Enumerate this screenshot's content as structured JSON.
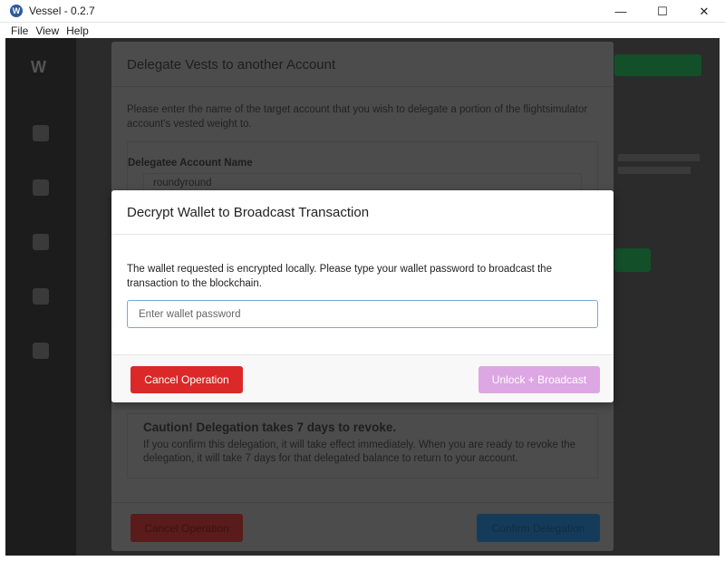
{
  "window": {
    "title": "Vessel - 0.2.7",
    "app_icon_glyph": "W",
    "minimize_glyph": "—",
    "maximize_glyph": "☐",
    "close_glyph": "✕"
  },
  "menu": [
    {
      "label": "File"
    },
    {
      "label": "View"
    },
    {
      "label": "Help"
    }
  ],
  "delegate_modal": {
    "title": "Delegate Vests to another Account",
    "description": "Please enter the name of the target account that you wish to delegate a portion of the flightsimulator account's vested weight to.",
    "field_label": "Delegatee Account Name",
    "field_value": "roundyround",
    "caution_title": "Caution! Delegation takes 7 days to revoke.",
    "caution_text": "If you confirm this delegation, it will take effect immediately. When you are ready to revoke the delegation, it will take 7 days for that delegated balance to return to your account.",
    "cancel_label": "Cancel Operation",
    "confirm_label": "Confirm Delegation"
  },
  "decrypt_modal": {
    "title": "Decrypt Wallet to Broadcast Transaction",
    "description": "The wallet requested is encrypted locally. Please type your wallet password to broadcast the transaction to the blockchain.",
    "password_placeholder": "Enter wallet password",
    "cancel_label": "Cancel Operation",
    "unlock_label": "Unlock + Broadcast"
  },
  "colors": {
    "cancel_red": "#db2828",
    "unlock_purple": "#dca7e2",
    "input_focus_border": "#7aa7d4",
    "overlay_bg": "#2b2b2b"
  }
}
